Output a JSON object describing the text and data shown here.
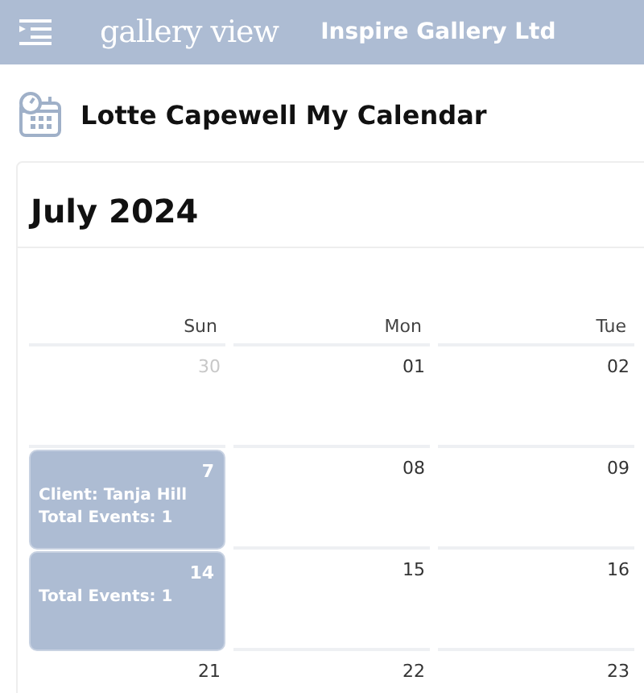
{
  "header": {
    "logo": "gallery view",
    "company": "Inspire Gallery Ltd"
  },
  "page_title": "Lotte Capewell My Calendar",
  "calendar": {
    "month": "July 2024",
    "weekdays": [
      "Sun",
      "Mon",
      "Tue"
    ],
    "weeks": [
      [
        {
          "day": "30",
          "outside_month": true,
          "has_events": false
        },
        {
          "day": "01",
          "outside_month": false,
          "has_events": false
        },
        {
          "day": "02",
          "outside_month": false,
          "has_events": false
        }
      ],
      [
        {
          "day": "7",
          "outside_month": false,
          "has_events": true,
          "lines": [
            "Client: Tanja Hill",
            "Total Events: 1"
          ]
        },
        {
          "day": "08",
          "outside_month": false,
          "has_events": false
        },
        {
          "day": "09",
          "outside_month": false,
          "has_events": false
        }
      ],
      [
        {
          "day": "14",
          "outside_month": false,
          "has_events": true,
          "lines": [
            "Total Events: 1"
          ]
        },
        {
          "day": "15",
          "outside_month": false,
          "has_events": false
        },
        {
          "day": "16",
          "outside_month": false,
          "has_events": false
        }
      ],
      [
        {
          "day": "21",
          "outside_month": false,
          "has_events": false
        },
        {
          "day": "22",
          "outside_month": false,
          "has_events": false
        },
        {
          "day": "23",
          "outside_month": false,
          "has_events": false
        }
      ]
    ]
  }
}
